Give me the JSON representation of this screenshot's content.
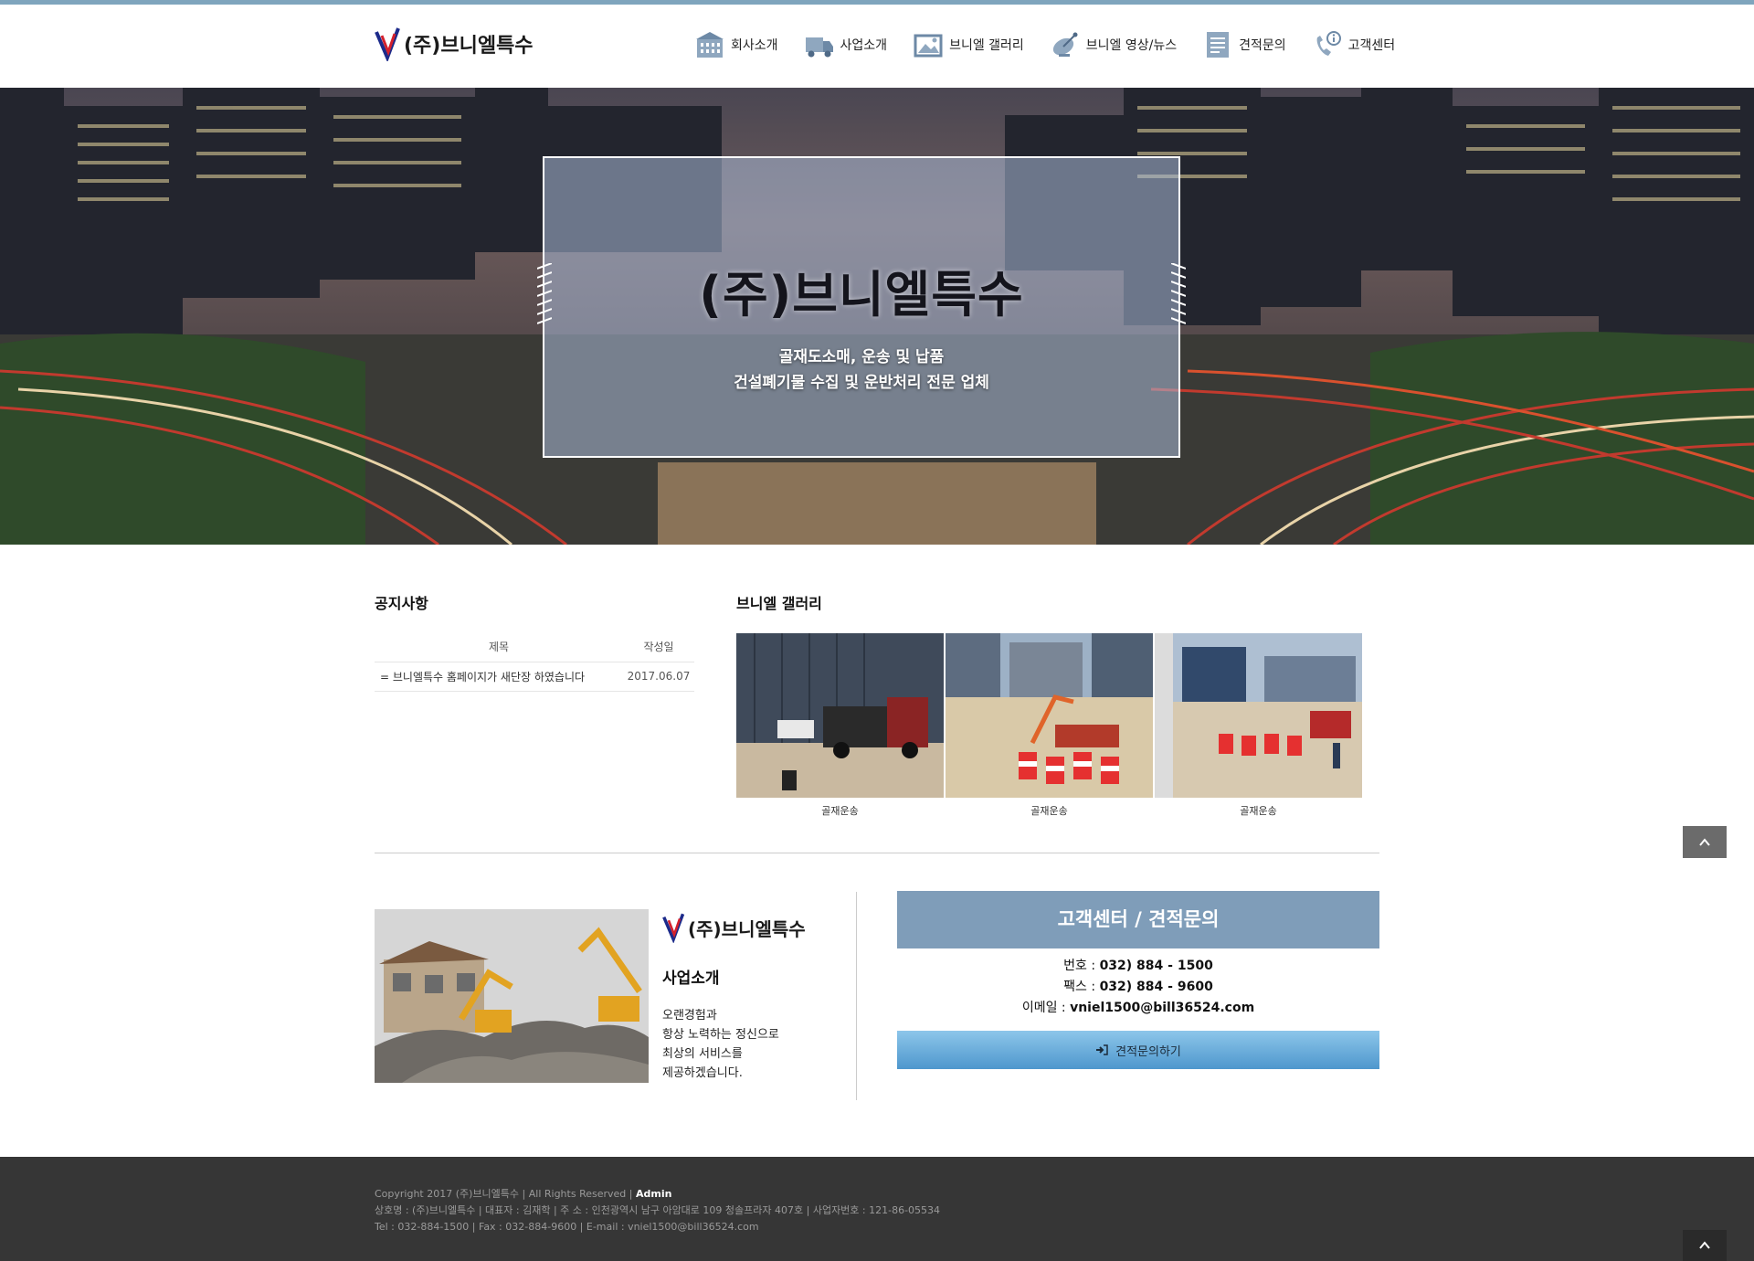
{
  "site": {
    "logo_text": "(주)브니엘특수"
  },
  "nav": [
    {
      "label": "회사소개",
      "icon": "building-icon"
    },
    {
      "label": "사업소개",
      "icon": "truck-icon"
    },
    {
      "label": "브니엘 갤러리",
      "icon": "gallery-icon"
    },
    {
      "label": "브니엘 영상/뉴스",
      "icon": "satellite-icon"
    },
    {
      "label": "견적문의",
      "icon": "document-icon"
    },
    {
      "label": "고객센터",
      "icon": "phone-info-icon"
    }
  ],
  "hero": {
    "title": "(주)브니엘특수",
    "line1": "골재도소매, 운송 및 납품",
    "line2": "건설폐기물 수집 및 운반처리 전문 업체"
  },
  "notice": {
    "title": "공지사항",
    "col_title": "제목",
    "col_date": "작성일",
    "rows": [
      {
        "title": "= 브니엘특수 홈페이지가 새단장 하였습니다",
        "date": "2017.06.07"
      }
    ]
  },
  "gallery": {
    "title": "브니엘 갤러리",
    "items": [
      {
        "caption": "골재운송"
      },
      {
        "caption": "골재운송"
      },
      {
        "caption": "골재운송"
      }
    ]
  },
  "business": {
    "logo_text": "(주)브니엘특수",
    "title": "사업소개",
    "lines": [
      "오랜경험과",
      "항상 노력하는 정신으로",
      "최상의 서비스를",
      "제공하겠습니다."
    ]
  },
  "customer_center": {
    "title": "고객센터 / 견적문의",
    "phone_label": "번호 : ",
    "phone": "032) 884 - 1500",
    "fax_label": "팩스 : ",
    "fax": "032) 884 - 9600",
    "email_label": "이메일 : ",
    "email": "vniel1500@bill36524.com",
    "button_label": "견적문의하기"
  },
  "footer": {
    "copyright": "Copyright 2017 (주)브니엘특수 | All Rights Reserved | ",
    "admin": "Admin",
    "line2": "상호명 : (주)브니엘특수 | 대표자 : 김재학 | 주 소 : 인천광역시 남구 아암대로 109 청솔프라자 407호 | 사업자번호 : 121-86-05534",
    "line3": "Tel : 032-884-1500 | Fax : 032-884-9600 | E-mail : vniel1500@bill36524.com"
  },
  "colors": {
    "accent_blue": "#7f9db9",
    "button_blue": "#5aa2d4",
    "footer_bg": "#363636",
    "top_line": "#7fa5bd"
  }
}
